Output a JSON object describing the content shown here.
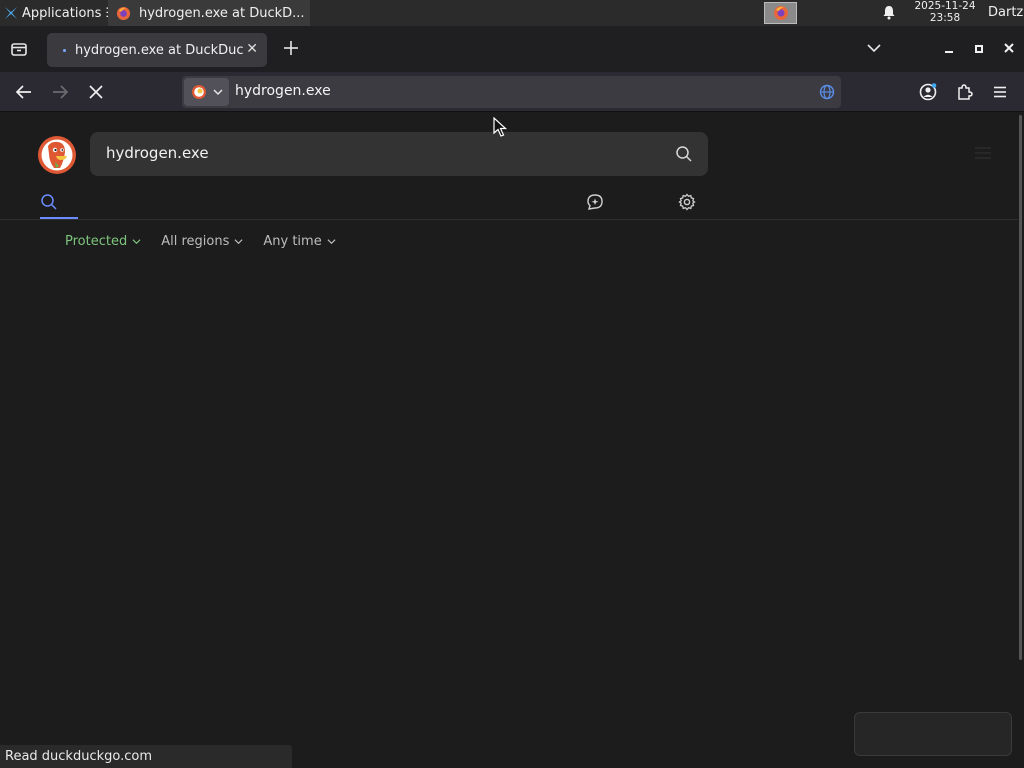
{
  "panel": {
    "applications_label": "Applications ☰",
    "task_title": "hydrogen.exe at DuckD...",
    "clock_date": "2025-11-24",
    "clock_time": "23:58",
    "user": "Dartz"
  },
  "browser": {
    "tab_title": "hydrogen.exe at DuckDuckGo",
    "url": "hydrogen.exe"
  },
  "page": {
    "search_query": "hydrogen.exe",
    "filters": [
      {
        "label": "Protected",
        "color": "#7dc47d"
      },
      {
        "label": "All regions"
      },
      {
        "label": "Any time"
      }
    ]
  },
  "status": {
    "text": "Read duckduckgo.com"
  },
  "icons": [
    "xfce-icon",
    "firefox-icon",
    "bell-icon",
    "list-all-tabs-icon",
    "new-tab-icon",
    "chevron-down-icon",
    "minimize-icon",
    "maximize-icon",
    "close-icon",
    "back-icon",
    "forward-icon",
    "stop-icon",
    "duckduckgo-site-icon",
    "globe-icon",
    "account-icon",
    "extensions-icon",
    "menu-icon",
    "search-icon",
    "duck-ai-chat-icon",
    "settings-gear-icon"
  ],
  "colors": {
    "accent": "#6b8cff",
    "protected": "#7dc47d",
    "background": "#1c1c1c"
  }
}
